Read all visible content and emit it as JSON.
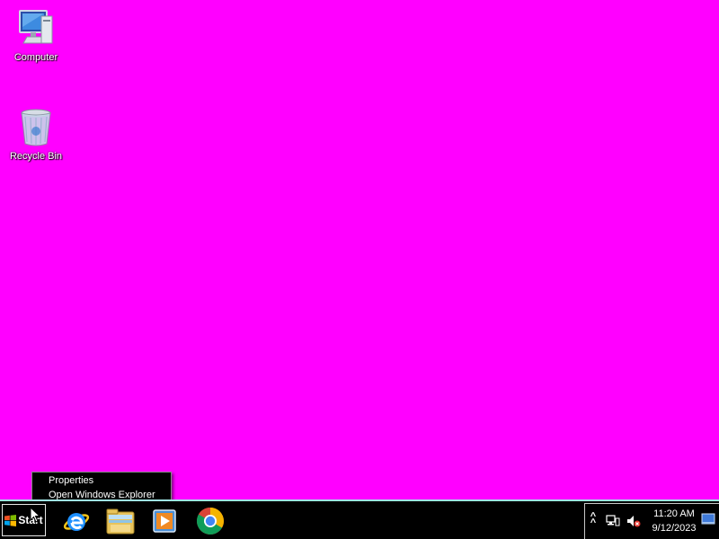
{
  "desktop": {
    "background_color": "#ff00ff",
    "icons": [
      {
        "label": "Computer",
        "icon": "computer-icon"
      },
      {
        "label": "Recycle Bin",
        "icon": "recycle-bin-icon"
      }
    ]
  },
  "context_menu": {
    "items": [
      {
        "label": "Properties"
      },
      {
        "label": "Open Windows Explorer"
      }
    ]
  },
  "taskbar": {
    "start_label": "Start",
    "pinned_apps": [
      {
        "name": "Internet Explorer",
        "icon": "internet-explorer-icon"
      },
      {
        "name": "Windows Explorer",
        "icon": "file-explorer-icon"
      },
      {
        "name": "Windows Media Player",
        "icon": "media-player-icon"
      },
      {
        "name": "Google Chrome",
        "icon": "chrome-icon"
      }
    ],
    "tray": {
      "time": "11:20 AM",
      "date": "9/12/2023",
      "icons": [
        "show-hidden-icons-icon",
        "network-icon",
        "volume-muted-icon",
        "show-desktop-icon"
      ]
    },
    "accent_color": "#9fe3e3"
  }
}
